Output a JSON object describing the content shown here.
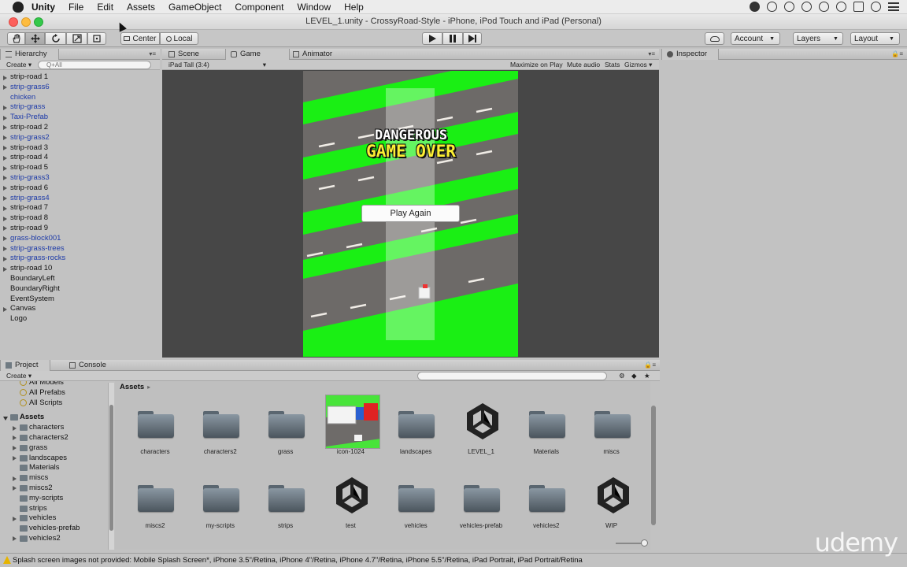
{
  "menubar": {
    "app": "Unity",
    "items": [
      "File",
      "Edit",
      "Assets",
      "GameObject",
      "Component",
      "Window",
      "Help"
    ]
  },
  "window": {
    "title": "LEVEL_1.unity - CrossyRoad-Style - iPhone, iPod Touch and iPad (Personal)"
  },
  "toolbar": {
    "pivot_label": "Center",
    "space_label": "Local",
    "account_label": "Account",
    "layers_label": "Layers",
    "layout_label": "Layout"
  },
  "hierarchy": {
    "tab": "Hierarchy",
    "create": "Create",
    "search_placeholder": "Q+All",
    "items": [
      {
        "label": "strip-road 1",
        "prefab": false,
        "arrow": true
      },
      {
        "label": "strip-grass6",
        "prefab": true,
        "arrow": true
      },
      {
        "label": "chicken",
        "prefab": true,
        "arrow": false
      },
      {
        "label": "strip-grass",
        "prefab": true,
        "arrow": true
      },
      {
        "label": "Taxi-Prefab",
        "prefab": true,
        "arrow": true
      },
      {
        "label": "strip-road 2",
        "prefab": false,
        "arrow": true
      },
      {
        "label": "strip-grass2",
        "prefab": true,
        "arrow": true
      },
      {
        "label": "strip-road 3",
        "prefab": false,
        "arrow": true
      },
      {
        "label": "strip-road 4",
        "prefab": false,
        "arrow": true
      },
      {
        "label": "strip-road 5",
        "prefab": false,
        "arrow": true
      },
      {
        "label": "strip-grass3",
        "prefab": true,
        "arrow": true
      },
      {
        "label": "strip-road 6",
        "prefab": false,
        "arrow": true
      },
      {
        "label": "strip-grass4",
        "prefab": true,
        "arrow": true
      },
      {
        "label": "strip-road 7",
        "prefab": false,
        "arrow": true
      },
      {
        "label": "strip-road 8",
        "prefab": false,
        "arrow": true
      },
      {
        "label": "strip-road 9",
        "prefab": false,
        "arrow": true
      },
      {
        "label": "grass-block001",
        "prefab": true,
        "arrow": true
      },
      {
        "label": "strip-grass-trees",
        "prefab": true,
        "arrow": true
      },
      {
        "label": "strip-grass-rocks",
        "prefab": true,
        "arrow": true
      },
      {
        "label": "strip-road 10",
        "prefab": false,
        "arrow": true
      },
      {
        "label": "BoundaryLeft",
        "prefab": false,
        "arrow": false
      },
      {
        "label": "BoundaryRight",
        "prefab": false,
        "arrow": false
      },
      {
        "label": "EventSystem",
        "prefab": false,
        "arrow": false
      },
      {
        "label": "Canvas",
        "prefab": false,
        "arrow": true
      },
      {
        "label": "Logo",
        "prefab": false,
        "arrow": false
      }
    ]
  },
  "gameview": {
    "tabs": [
      "Scene",
      "Game",
      "Animator"
    ],
    "aspect": "iPad Tall (3:4)",
    "options": [
      "Maximize on Play",
      "Mute audio",
      "Stats",
      "Gizmos"
    ],
    "logo_text": "DANGEROUS",
    "gameover_text": "GAME OVER",
    "play_again": "Play Again"
  },
  "inspector": {
    "tab": "Inspector"
  },
  "project": {
    "tabs": [
      "Project",
      "Console"
    ],
    "create": "Create",
    "breadcrumb": "Assets",
    "favorites": [
      "All Models",
      "All Prefabs",
      "All Scripts"
    ],
    "tree_root": "Assets",
    "tree": [
      {
        "label": "characters",
        "arrow": true
      },
      {
        "label": "characters2",
        "arrow": true
      },
      {
        "label": "grass",
        "arrow": true
      },
      {
        "label": "landscapes",
        "arrow": true
      },
      {
        "label": "Materials",
        "arrow": false
      },
      {
        "label": "miscs",
        "arrow": true
      },
      {
        "label": "miscs2",
        "arrow": true
      },
      {
        "label": "my-scripts",
        "arrow": false
      },
      {
        "label": "strips",
        "arrow": false
      },
      {
        "label": "vehicles",
        "arrow": true
      },
      {
        "label": "vehicles-prefab",
        "arrow": false
      },
      {
        "label": "vehicles2",
        "arrow": true
      }
    ],
    "assets": [
      {
        "label": "characters",
        "kind": "folder"
      },
      {
        "label": "characters2",
        "kind": "folder"
      },
      {
        "label": "grass",
        "kind": "folder"
      },
      {
        "label": "icon-1024",
        "kind": "image"
      },
      {
        "label": "landscapes",
        "kind": "folder"
      },
      {
        "label": "LEVEL_1",
        "kind": "unity"
      },
      {
        "label": "Materials",
        "kind": "folder"
      },
      {
        "label": "miscs",
        "kind": "folder"
      },
      {
        "label": "miscs2",
        "kind": "folder"
      },
      {
        "label": "my-scripts",
        "kind": "folder"
      },
      {
        "label": "strips",
        "kind": "folder"
      },
      {
        "label": "test",
        "kind": "unity"
      },
      {
        "label": "vehicles",
        "kind": "folder"
      },
      {
        "label": "vehicles-prefab",
        "kind": "folder"
      },
      {
        "label": "vehicles2",
        "kind": "folder"
      },
      {
        "label": "WIP",
        "kind": "unity"
      }
    ]
  },
  "status": {
    "message": "Splash screen images not provided: Mobile Splash Screen*, iPhone 3.5\"/Retina, iPhone 4\"/Retina, iPhone 4.7\"/Retina, iPhone 5.5\"/Retina, iPad Portrait, iPad Portrait/Retina"
  },
  "watermark": "udemy",
  "colors": {
    "grass": "#1aef14",
    "road": "#6d6a68",
    "prefab_text": "#1d3aa8",
    "gameover": "#fcef34"
  }
}
